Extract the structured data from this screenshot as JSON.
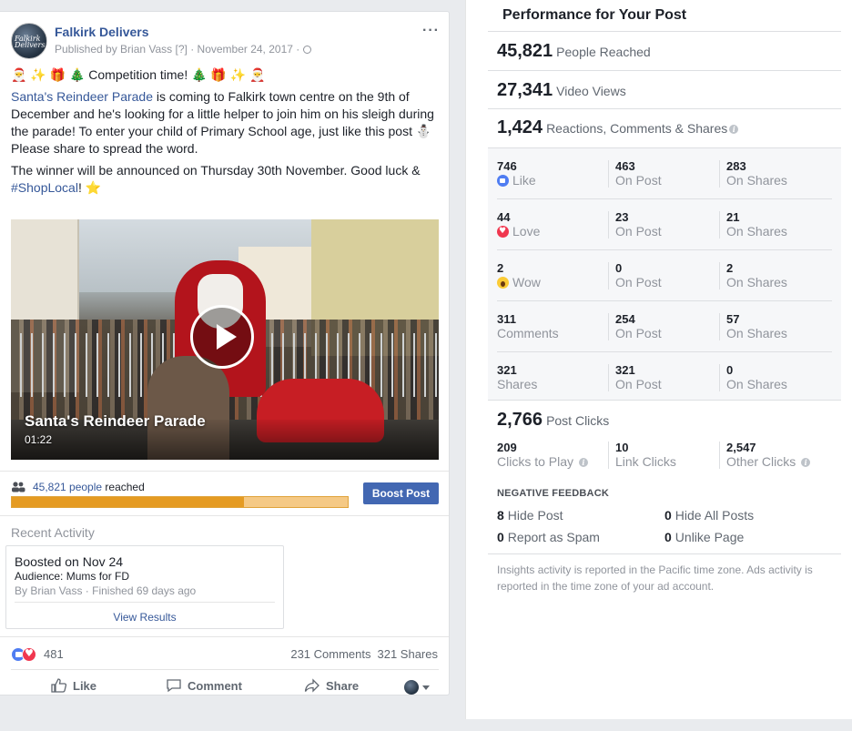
{
  "post": {
    "page_name": "Falkirk Delivers",
    "avatar_text": "Falkirk Delivers",
    "meta": "Published by Brian Vass [?] · November 24, 2017 · ",
    "more_label": "···",
    "text_line1": "🎅 ✨ 🎁 🎄 Competition time! 🎄 🎁 ✨ 🎅",
    "parade_link": "Santa's Reindeer Parade",
    "text_para1": " is coming to Falkirk town centre on the 9th of December and he's looking for a little helper to join him on his sleigh during the parade! To enter your child of Primary School age, just like this post ⛄ Please share to spread the word.",
    "text_para2_pre": "The winner will be announced on Thursday 30th November. Good luck & ",
    "hashtag": "#ShopLocal",
    "text_para2_post": "! ⭐",
    "video": {
      "title": "Santa's Reindeer Parade",
      "duration": "01:22"
    },
    "reach": {
      "count": "45,821 people",
      "suffix": " reached",
      "progress_fraction": 0.69
    },
    "boost_label": "Boost Post",
    "recent_activity_title": "Recent Activity",
    "boost_card": {
      "title": "Boosted on Nov 24",
      "audience": "Audience: Mums for FD",
      "by": "By Brian Vass · Finished 69 days ago",
      "view_results": "View Results"
    },
    "reactions_count": "481",
    "comments_count": "231 Comments",
    "shares_count": "321 Shares",
    "actions": {
      "like": "Like",
      "comment": "Comment",
      "share": "Share"
    }
  },
  "performance": {
    "title": "Performance for Your Post",
    "people_reached": {
      "value": "45,821",
      "label": "People Reached"
    },
    "video_views": {
      "value": "27,341",
      "label": "Video Views"
    },
    "engagement": {
      "value": "1,424",
      "label": "Reactions, Comments & Shares"
    },
    "breakdown": [
      {
        "c1_num": "746",
        "c1_cap": "Like",
        "c1_icon": "like-icon",
        "c2_num": "463",
        "c2_cap": "On Post",
        "c3_num": "283",
        "c3_cap": "On Shares"
      },
      {
        "c1_num": "44",
        "c1_cap": "Love",
        "c1_icon": "love-icon",
        "c2_num": "23",
        "c2_cap": "On Post",
        "c3_num": "21",
        "c3_cap": "On Shares"
      },
      {
        "c1_num": "2",
        "c1_cap": "Wow",
        "c1_icon": "wow-icon",
        "c2_num": "0",
        "c2_cap": "On Post",
        "c3_num": "2",
        "c3_cap": "On Shares"
      },
      {
        "c1_num": "311",
        "c1_cap": "Comments",
        "c2_num": "254",
        "c2_cap": "On Post",
        "c3_num": "57",
        "c3_cap": "On Shares"
      },
      {
        "c1_num": "321",
        "c1_cap": "Shares",
        "c2_num": "321",
        "c2_cap": "On Post",
        "c3_num": "0",
        "c3_cap": "On Shares"
      }
    ],
    "post_clicks": {
      "value": "2,766",
      "label": "Post Clicks"
    },
    "clicks": [
      {
        "num": "209",
        "cap": "Clicks to Play"
      },
      {
        "num": "10",
        "cap": "Link Clicks"
      },
      {
        "num": "2,547",
        "cap": "Other Clicks"
      }
    ],
    "negative_title": "NEGATIVE FEEDBACK",
    "negative": {
      "hide_post": {
        "num": "8",
        "label": "Hide Post"
      },
      "hide_all": {
        "num": "0",
        "label": "Hide All Posts"
      },
      "spam": {
        "num": "0",
        "label": "Report as Spam"
      },
      "unlike": {
        "num": "0",
        "label": "Unlike Page"
      }
    },
    "footnote": "Insights activity is reported in the Pacific time zone. Ads activity is reported in the time zone of your ad account."
  },
  "colors": {
    "link": "#365899",
    "boost_button": "#4267b2",
    "progress_fill": "#e59b22",
    "progress_track": "#f5c985"
  }
}
